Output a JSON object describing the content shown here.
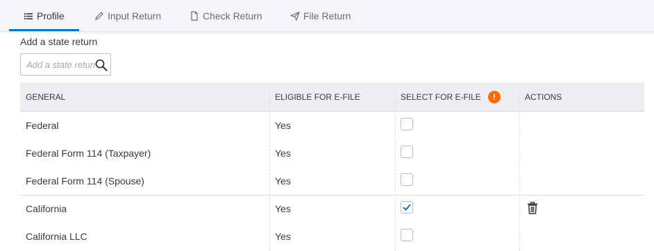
{
  "tabs": [
    {
      "label": "Profile",
      "icon": "list-icon",
      "active": true
    },
    {
      "label": "Input Return",
      "icon": "pencil-icon",
      "active": false
    },
    {
      "label": "Check Return",
      "icon": "document-icon",
      "active": false
    },
    {
      "label": "File Return",
      "icon": "paper-plane-icon",
      "active": false
    }
  ],
  "state_return": {
    "label": "Add a state return",
    "placeholder": "Add a state return"
  },
  "table": {
    "headers": {
      "general": "GENERAL",
      "eligible": "ELIGIBLE FOR E-FILE",
      "select": "SELECT FOR E-FILE",
      "warning_glyph": "!",
      "actions": "ACTIONS"
    },
    "rows": [
      {
        "name": "Federal",
        "eligible": "Yes",
        "selected": false,
        "deletable": false
      },
      {
        "name": "Federal Form 114 (Taxpayer)",
        "eligible": "Yes",
        "selected": false,
        "deletable": false
      },
      {
        "name": "Federal Form 114 (Spouse)",
        "eligible": "Yes",
        "selected": false,
        "deletable": false
      },
      {
        "name": "California",
        "eligible": "Yes",
        "selected": true,
        "deletable": true
      },
      {
        "name": "California LLC",
        "eligible": "Yes",
        "selected": false,
        "deletable": false
      }
    ]
  },
  "colors": {
    "accent": "#0077c5",
    "warning": "#ff6a00",
    "header_bg": "#eceef1"
  }
}
